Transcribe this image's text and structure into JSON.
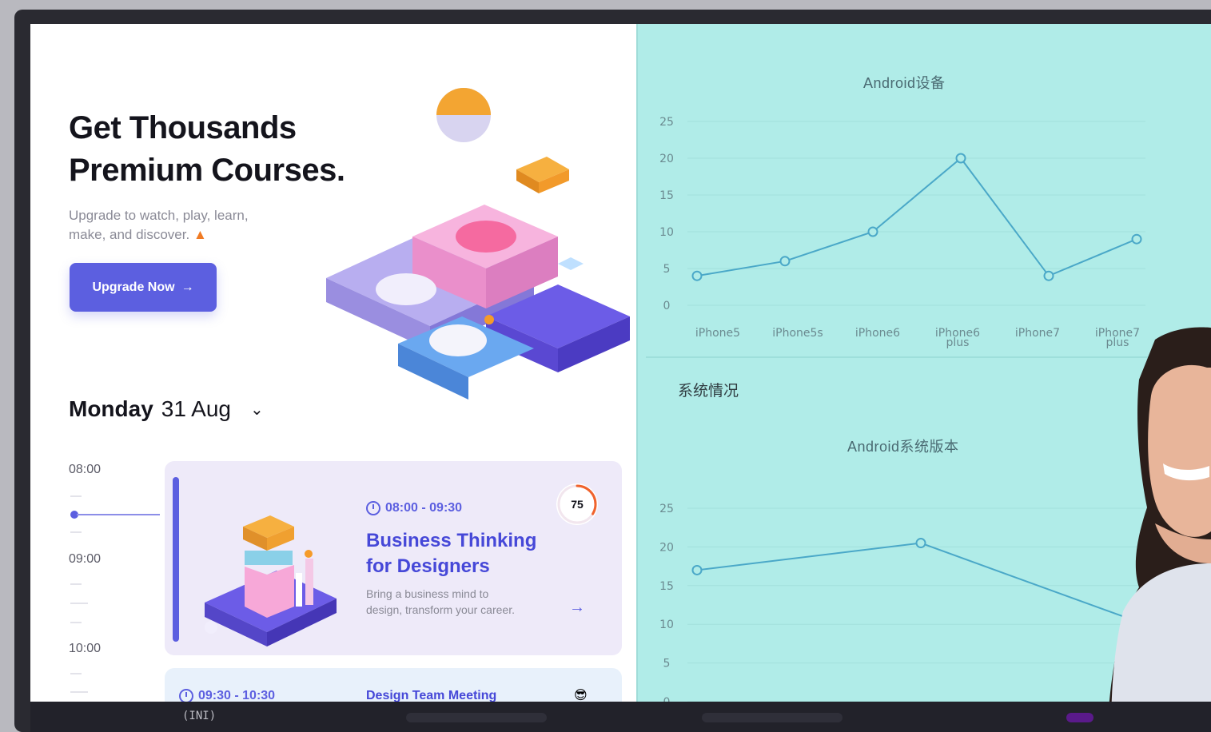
{
  "hero": {
    "title_line1": "Get Thousands",
    "title_line2": "Premium Courses.",
    "subtitle_line1": "Upgrade to watch, play, learn,",
    "subtitle_line2": "make, and discover.",
    "cta_label": "Upgrade Now",
    "cta_icon": "arrow-right-icon"
  },
  "schedule": {
    "day": "Monday",
    "date": "31 Aug",
    "dropdown_icon": "chevron-down-icon",
    "times": [
      "08:00",
      "09:00",
      "10:00"
    ]
  },
  "cards": [
    {
      "time": "08:00 - 09:30",
      "title_line1": "Business Thinking",
      "title_line2": "for Designers",
      "desc_line1": "Bring a business mind to",
      "desc_line2": "design, transform your career.",
      "score": "75",
      "accent": "#5c5fe0"
    },
    {
      "time": "09:30 - 10:30",
      "title": "Design Team Meeting",
      "emoji": "😎"
    }
  ],
  "dashboard": {
    "section_title": "系统情况",
    "background": "#b0ece8",
    "line_color": "#4aa8c8"
  },
  "chart_data": [
    {
      "type": "line",
      "title": "Android设备",
      "categories": [
        "iPhone5",
        "iPhone5s",
        "iPhone6",
        "iPhone6 plus",
        "iPhone7",
        "iPhone7 plus"
      ],
      "values": [
        4,
        6,
        10,
        20,
        4,
        9
      ],
      "ylim": [
        0,
        25
      ],
      "yticks": [
        0,
        5,
        10,
        15,
        20,
        25
      ],
      "grid": true
    },
    {
      "type": "line",
      "title": "Android系统版本",
      "x": [
        0,
        1,
        2
      ],
      "values": [
        17,
        20.5,
        10
      ],
      "ylim": [
        0,
        25
      ],
      "yticks": [
        0,
        5,
        10,
        15,
        20,
        25
      ],
      "grid": true
    }
  ],
  "taskbar": {
    "label": "(INI)"
  }
}
